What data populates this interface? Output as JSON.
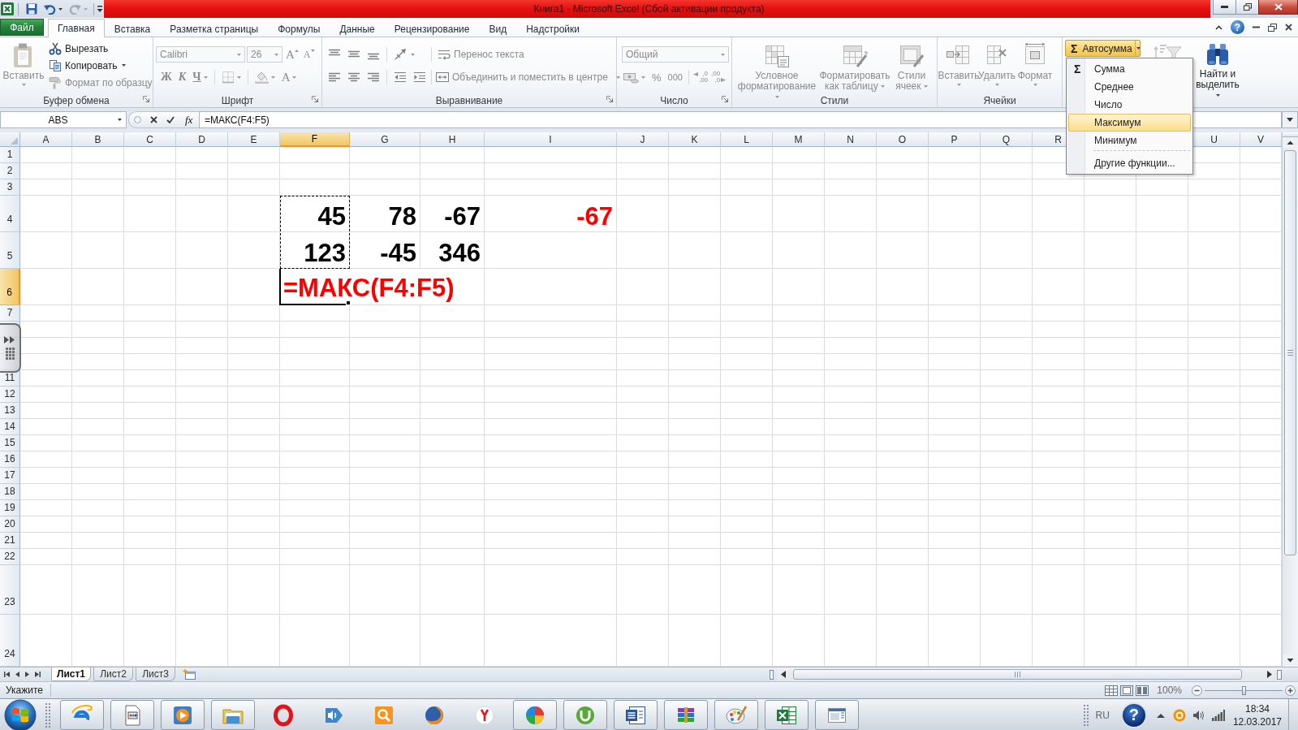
{
  "title_bar": {
    "quick_access": [
      {
        "kind": "save",
        "disabled": false
      },
      {
        "kind": "undo",
        "disabled": false
      },
      {
        "kind": "redo",
        "disabled": true
      }
    ],
    "title": "Книга1 - Microsoft Excel (Сбой активации продукта)"
  },
  "ribbon": {
    "tabs": [
      {
        "label": "Файл",
        "kind": "backstage",
        "selected": false
      },
      {
        "label": "Главная",
        "kind": "tab",
        "selected": true
      },
      {
        "label": "Вставка",
        "kind": "tab",
        "selected": false
      },
      {
        "label": "Разметка страницы",
        "kind": "tab",
        "selected": false
      },
      {
        "label": "Формулы",
        "kind": "tab",
        "selected": false
      },
      {
        "label": "Данные",
        "kind": "tab",
        "selected": false
      },
      {
        "label": "Рецензирование",
        "kind": "tab",
        "selected": false
      },
      {
        "label": "Вид",
        "kind": "tab",
        "selected": false
      },
      {
        "label": "Надстройки",
        "kind": "tab",
        "selected": false
      }
    ],
    "help_symbol": "?",
    "clipboard": {
      "label": "Буфер обмена",
      "paste": {
        "label": "Вставить",
        "disabled": true
      },
      "commands": [
        {
          "kind": "cut",
          "label": "Вырезать",
          "disabled": false
        },
        {
          "kind": "copy",
          "label": "Копировать",
          "disabled": false
        },
        {
          "kind": "painter",
          "label": "Формат по образцу",
          "disabled": true
        }
      ]
    },
    "font": {
      "label": "Шрифт",
      "disabled": true,
      "font_name": "Calibri",
      "font_size": "26",
      "grow": "A",
      "shrink": "A",
      "bold": "Ж",
      "italic": "К",
      "underline": "Ч",
      "font_color": "A"
    },
    "alignment": {
      "label": "Выравнивание",
      "disabled": true,
      "wrap_text": "Перенос текста",
      "merge": "Объединить и поместить в центре"
    },
    "number": {
      "label": "Число",
      "disabled": true,
      "format": "Общий",
      "percent": "%",
      "thousands": "000",
      "increase_decimal": [
        ",0",
        ",00"
      ],
      "decrease_decimal": [
        ",00",
        ",0"
      ]
    },
    "styles": {
      "label": "Стили",
      "disabled": true,
      "buttons": [
        "Условное форматирование",
        "Форматировать как таблицу",
        "Стили ячеек"
      ]
    },
    "cells": {
      "label": "Ячейки",
      "disabled": true,
      "buttons": [
        "Вставить",
        "Удалить",
        "Формат"
      ]
    },
    "editing": {
      "autosum": {
        "symbol": "Σ",
        "label": "Автосумма",
        "expanded": true,
        "menu": [
          {
            "kind": "function",
            "symbol": "Σ",
            "label": "Сумма",
            "selected": false
          },
          {
            "kind": "function",
            "label": "Среднее",
            "selected": false
          },
          {
            "kind": "function",
            "label": "Число",
            "selected": false
          },
          {
            "kind": "function",
            "label": "Максимум",
            "selected": true
          },
          {
            "kind": "function",
            "label": "Минимум",
            "selected": false
          },
          {
            "kind": "more",
            "label": "Другие функции...",
            "selected": false
          }
        ]
      },
      "find": {
        "label": "Найти и выделить",
        "disabled": false
      }
    }
  },
  "formula_bar": {
    "name_box": "ABS",
    "function_button": "fx",
    "formula": "=МАКС(F4:F5)"
  },
  "sheet": {
    "columns": [
      {
        "label": "A",
        "selected": false
      },
      {
        "label": "B",
        "selected": false
      },
      {
        "label": "C",
        "selected": false
      },
      {
        "label": "D",
        "selected": false
      },
      {
        "label": "E",
        "selected": false
      },
      {
        "label": "F",
        "selected": true
      },
      {
        "label": "G",
        "selected": false
      },
      {
        "label": "H",
        "selected": false
      },
      {
        "label": "I",
        "selected": false
      },
      {
        "label": "J",
        "selected": false
      },
      {
        "label": "K",
        "selected": false
      },
      {
        "label": "L",
        "selected": false
      },
      {
        "label": "M",
        "selected": false
      },
      {
        "label": "N",
        "selected": false
      },
      {
        "label": "O",
        "selected": false
      },
      {
        "label": "P",
        "selected": false
      },
      {
        "label": "Q",
        "selected": false
      },
      {
        "label": "R",
        "selected": false
      },
      null,
      null,
      {
        "label": "U",
        "selected": false
      },
      {
        "label": "V",
        "selected": false
      }
    ],
    "rows": [
      {
        "label": "1",
        "selected": false
      },
      {
        "label": "2",
        "selected": false
      },
      {
        "label": "3",
        "selected": false
      },
      {
        "label": "4",
        "selected": false,
        "cells": [
          null,
          null,
          null,
          null,
          null,
          {
            "kind": "number",
            "value": "45",
            "color": "#000000",
            "selected": false,
            "referenced": true
          },
          {
            "kind": "number",
            "value": "78",
            "color": "#000000",
            "selected": false,
            "referenced": false
          },
          {
            "kind": "number",
            "value": "-67",
            "color": "#000000",
            "selected": false,
            "referenced": false
          },
          {
            "kind": "number",
            "value": "-67",
            "color": "#ff0000",
            "selected": false,
            "referenced": false
          }
        ]
      },
      {
        "label": "5",
        "selected": false,
        "cells": [
          null,
          null,
          null,
          null,
          null,
          {
            "kind": "number",
            "value": "123",
            "color": "#000000",
            "selected": false,
            "referenced": true
          },
          {
            "kind": "number",
            "value": "-45",
            "color": "#000000",
            "selected": false,
            "referenced": false
          },
          {
            "kind": "number",
            "value": "346",
            "color": "#000000",
            "selected": false,
            "referenced": false
          }
        ]
      },
      {
        "label": "6",
        "selected": true,
        "cells": [
          null,
          null,
          null,
          null,
          null,
          {
            "kind": "formula",
            "value": "=МАКС(F4:F5)",
            "color": "#ff0000",
            "selected": true,
            "referenced": false
          }
        ]
      },
      {
        "label": "7",
        "selected": false
      },
      {
        "selected": false
      },
      {
        "selected": false
      },
      {
        "selected": false
      },
      {
        "label": "11",
        "selected": false
      },
      {
        "label": "12",
        "selected": false
      },
      {
        "label": "13",
        "selected": false
      },
      {
        "label": "14",
        "selected": false
      },
      {
        "label": "15",
        "selected": false
      },
      {
        "label": "16",
        "selected": false
      },
      {
        "label": "17",
        "selected": false
      },
      {
        "label": "18",
        "selected": false
      },
      {
        "label": "19",
        "selected": false
      },
      {
        "label": "20",
        "selected": false
      },
      {
        "label": "21",
        "selected": false
      },
      {
        "label": "22",
        "selected": false
      },
      {
        "label": "23",
        "selected": false
      },
      {
        "label": "24",
        "selected": false
      }
    ]
  },
  "sheet_tabs": [
    {
      "label": "Лист1",
      "selected": true
    },
    {
      "label": "Лист2",
      "selected": false
    },
    {
      "label": "Лист3",
      "selected": false
    }
  ],
  "status_bar": {
    "mode": "Укажите",
    "zoom": "100%",
    "zoom_slider": {
      "level": 0.5
    }
  },
  "taskbar": {
    "apps": [
      {
        "kind": "ie",
        "running": true
      },
      {
        "kind": "notepad",
        "running": true
      },
      {
        "kind": "player",
        "running": true
      },
      {
        "kind": "explorer",
        "running": true
      },
      {
        "kind": "opera",
        "running": false
      },
      {
        "kind": "speaker",
        "running": false
      },
      {
        "kind": "search",
        "running": false
      },
      {
        "kind": "firefox",
        "running": false
      },
      {
        "kind": "yandex",
        "running": false
      },
      {
        "kind": "colorball",
        "running": true
      },
      {
        "kind": "torrent",
        "running": true
      },
      {
        "kind": "word",
        "running": true
      },
      {
        "kind": "archiver",
        "running": true
      },
      {
        "kind": "paint",
        "running": true
      },
      {
        "kind": "excel",
        "running": true
      },
      {
        "kind": "viewer",
        "running": true
      }
    ],
    "language": "RU",
    "help_symbol": "?",
    "time": "18:34",
    "date": "12.03.2017"
  }
}
